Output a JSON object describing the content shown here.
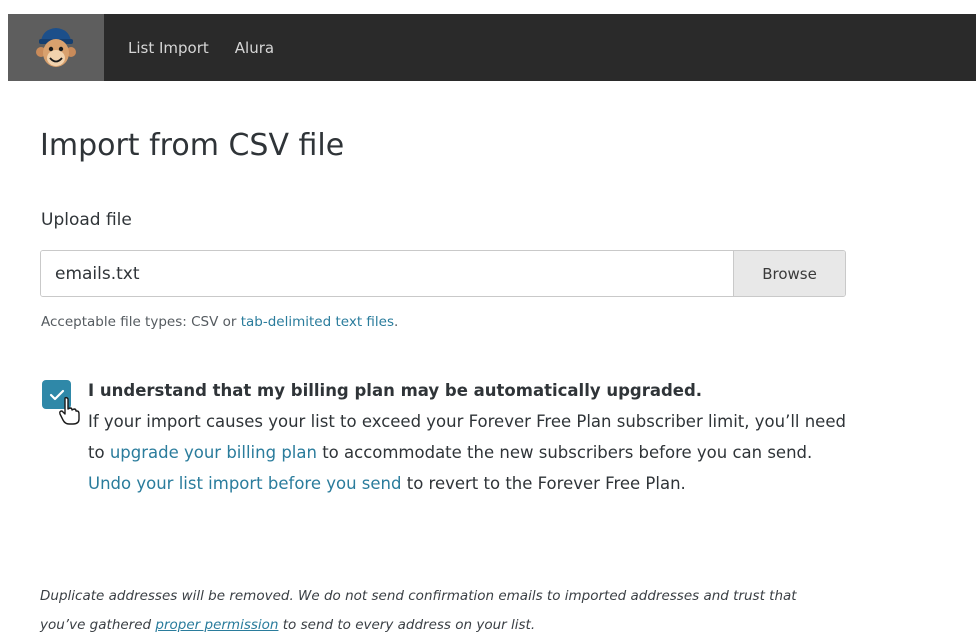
{
  "nav": {
    "logo_icon": "mailchimp-monkey-icon",
    "items": [
      {
        "label": "List Import"
      },
      {
        "label": "Alura"
      }
    ]
  },
  "page": {
    "title": "Import from CSV file"
  },
  "upload": {
    "label": "Upload file",
    "file_value": "emails.txt",
    "browse_label": "Browse",
    "help_prefix": "Acceptable file types: CSV or ",
    "help_link": "tab-delimited text files",
    "help_suffix": "."
  },
  "consent": {
    "checked": true,
    "title": "I understand that my billing plan may be automatically upgraded.",
    "body_1": "If your import causes your list to exceed your Forever Free Plan subscriber limit, you’ll need to ",
    "link_1": "upgrade your billing plan",
    "body_2": " to accommodate the new subscribers before you can send. ",
    "link_2": "Undo your list import before you send",
    "body_3": " to revert to the Forever Free Plan."
  },
  "footer": {
    "text_1": "Duplicate addresses will be removed. We do not send confirmation emails to imported addresses and trust that you’ve gathered ",
    "link": "proper permission",
    "text_2": " to send to every address on your list."
  },
  "colors": {
    "topbar": "#2a2a2a",
    "logo_cell": "#5e5e5e",
    "accent": "#2f88a8",
    "link": "#2a7c9c"
  }
}
